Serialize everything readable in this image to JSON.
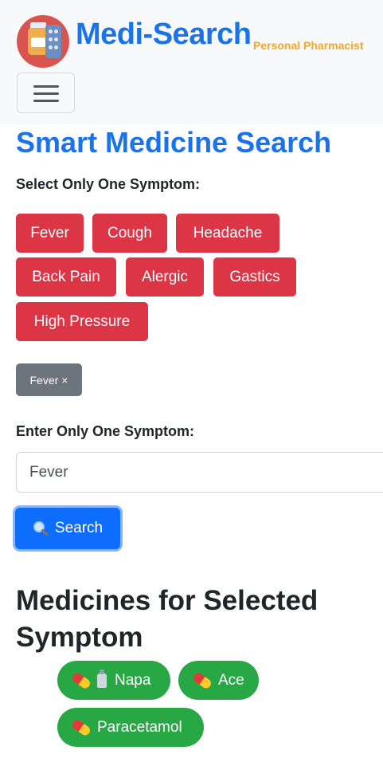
{
  "header": {
    "brand_title": "Medi-Search",
    "brand_subtitle": "Personal Pharmacist",
    "menu_icon": "hamburger-icon"
  },
  "main": {
    "title": "Smart Medicine Search",
    "select_label": "Select Only One Symptom:",
    "symptoms": [
      "Fever",
      "Cough",
      "Headache",
      "Back Pain",
      "Alergic",
      "Gastics",
      "High Pressure"
    ],
    "selected_chip": {
      "label": "Fever",
      "remove_glyph": "×"
    },
    "enter_label": "Enter Only One Symptom:",
    "input_value": "Fever",
    "search_button": {
      "icon": "magnifier-icon",
      "label": "Search"
    },
    "results_title": "Medicines for Selected Symptom",
    "medicines": [
      {
        "label": "Napa",
        "icons": [
          "pill-icon",
          "bottle-icon"
        ]
      },
      {
        "label": "Ace",
        "icons": [
          "pill-icon"
        ]
      },
      {
        "label": "Paracetamol",
        "icons": [
          "pill-icon"
        ]
      }
    ]
  },
  "colors": {
    "brand_blue": "#1a73e8",
    "subtitle_orange": "#f5a623",
    "symptom_red": "#dc3545",
    "chip_gray": "#6c757d",
    "search_blue": "#0d6efd",
    "medicine_green": "#28a745"
  }
}
